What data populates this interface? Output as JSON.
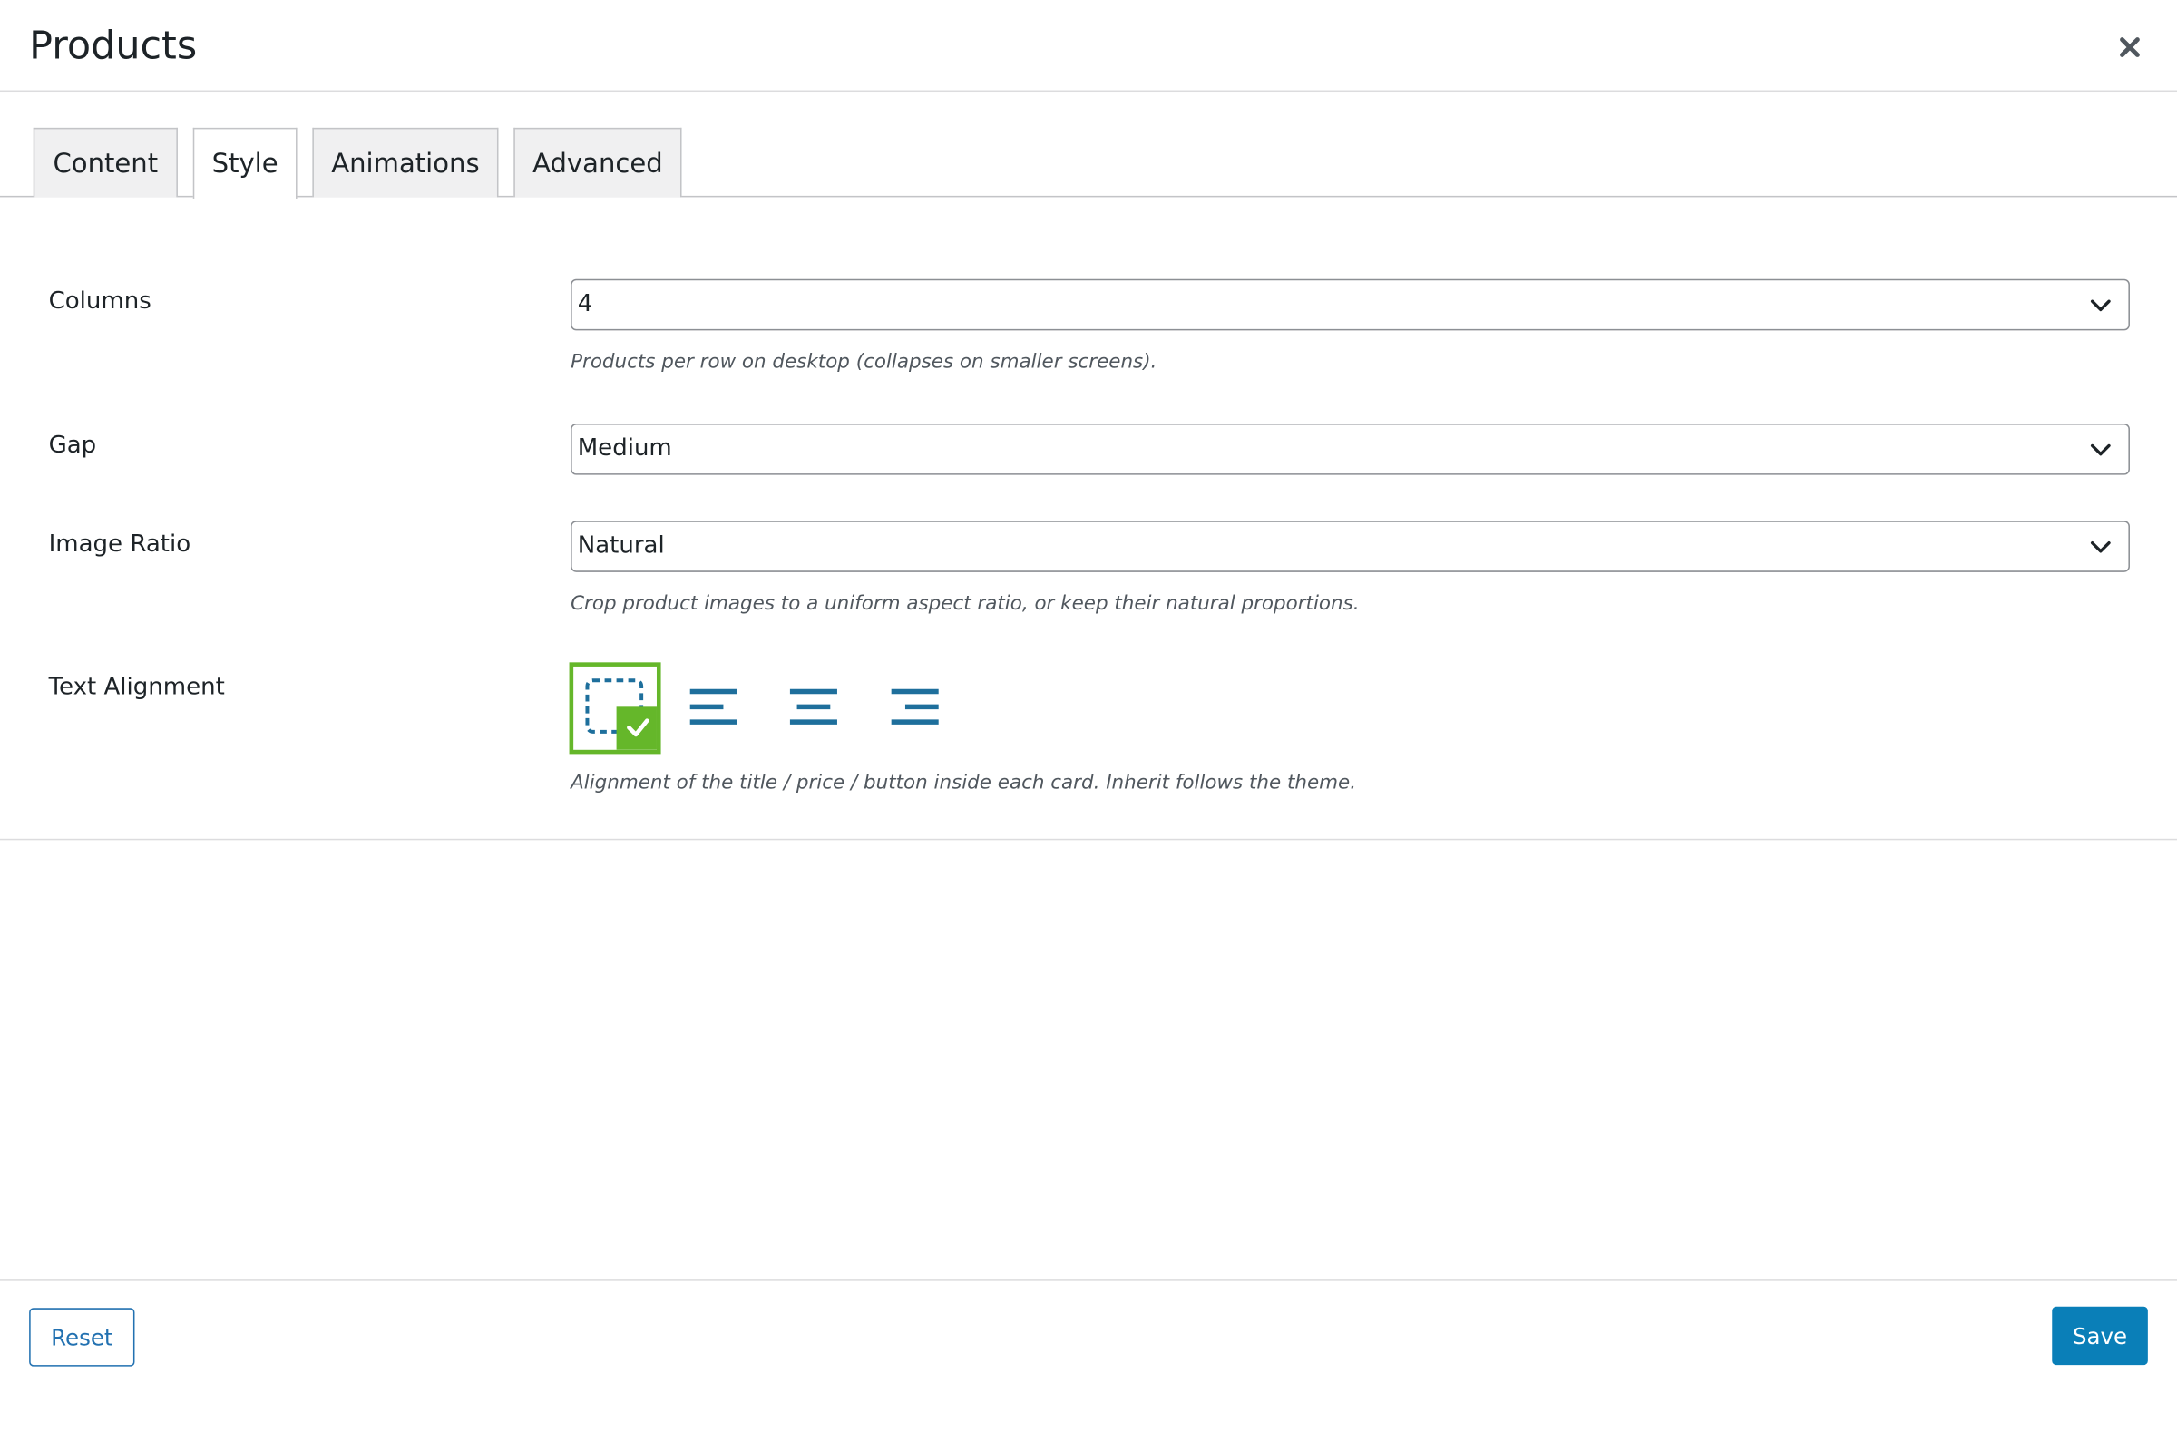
{
  "modal": {
    "title": "Products"
  },
  "tabs": [
    {
      "label": "Content"
    },
    {
      "label": "Style"
    },
    {
      "label": "Animations"
    },
    {
      "label": "Advanced"
    }
  ],
  "active_tab": "Style",
  "fields": {
    "columns": {
      "label": "Columns",
      "value": "4",
      "help": "Products per row on desktop (collapses on smaller screens)."
    },
    "gap": {
      "label": "Gap",
      "value": "Medium"
    },
    "image_ratio": {
      "label": "Image Ratio",
      "value": "Natural",
      "help": "Crop product images to a uniform aspect ratio, or keep their natural proportions."
    },
    "text_alignment": {
      "label": "Text Alignment",
      "options": [
        {
          "icon": "inherit-icon",
          "selected": true
        },
        {
          "icon": "align-left-icon",
          "selected": false
        },
        {
          "icon": "align-center-icon",
          "selected": false
        },
        {
          "icon": "align-right-icon",
          "selected": false
        }
      ],
      "help": "Alignment of the title / price / button inside each card. Inherit follows the theme."
    }
  },
  "footer": {
    "reset_label": "Reset",
    "save_label": "Save"
  },
  "colors": {
    "accent_blue": "#0a7fb8",
    "link_blue": "#2271b1",
    "icon_blue": "#1e6f9c",
    "selected_green": "#65b72a"
  }
}
